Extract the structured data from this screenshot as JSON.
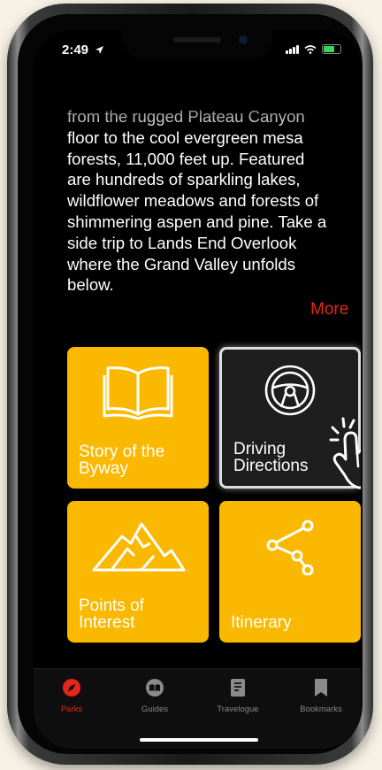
{
  "status_bar": {
    "time": "2:49"
  },
  "description": {
    "text": "from the rugged Plateau Canyon\nfloor to the cool evergreen mesa\nforests, 11,000 feet up. Featured\nare hundreds of sparkling lakes,\nwildflower meadows and forests of\nshimmering aspen and pine. Take a\nside trip to Lands End Overlook\nwhere the Grand Valley unfolds\nbelow.",
    "more_label": "More"
  },
  "tiles": [
    {
      "label": "Story of the\nByway",
      "icon": "open-book-icon"
    },
    {
      "label": "Driving\nDirections",
      "icon": "steering-wheel-icon",
      "selected": true
    },
    {
      "label": "Points of\nInterest",
      "icon": "mountains-icon"
    },
    {
      "label": "Itinerary",
      "icon": "share-nodes-icon"
    }
  ],
  "tab_bar": {
    "items": [
      {
        "label": "Parks",
        "icon": "compass-icon",
        "active": true
      },
      {
        "label": "Guides",
        "icon": "guides-icon"
      },
      {
        "label": "Travelogue",
        "icon": "notebook-icon"
      },
      {
        "label": "Bookmarks",
        "icon": "bookmark-icon"
      }
    ]
  },
  "colors": {
    "accent": "#e4261b",
    "tile": "#fbb800",
    "tile_selected": "#1e1e1e",
    "background": "#000000"
  }
}
